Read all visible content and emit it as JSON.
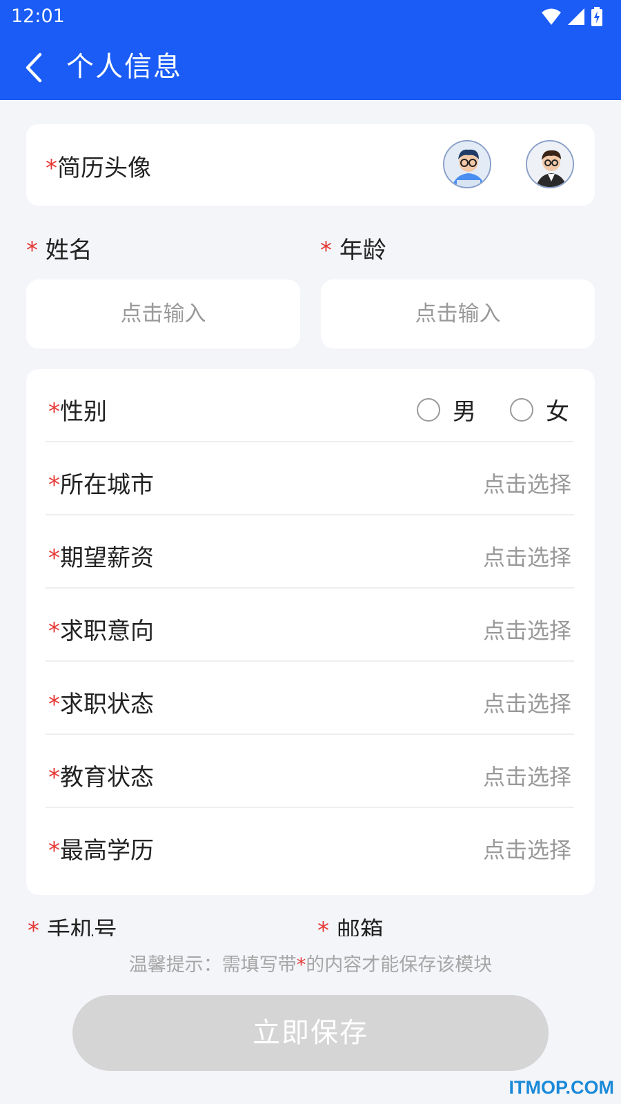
{
  "status_bar": {
    "time": "12:01",
    "icons": [
      "wifi-icon",
      "signal-icon",
      "battery-charging-icon"
    ]
  },
  "app_bar": {
    "title": "个人信息",
    "back_icon": "chevron-left-icon"
  },
  "avatar_section": {
    "required_mark": "*",
    "label": "简历头像",
    "avatars": [
      "male-avatar-blue-shirt",
      "male-avatar-black-suit"
    ]
  },
  "name_field": {
    "required_mark": "*",
    "label": "姓名",
    "placeholder": "点击输入"
  },
  "age_field": {
    "required_mark": "*",
    "label": "年龄",
    "placeholder": "点击输入"
  },
  "form_rows": {
    "gender": {
      "required_mark": "*",
      "label": "性别",
      "options": [
        "男",
        "女"
      ]
    },
    "city": {
      "required_mark": "*",
      "label": "所在城市",
      "value": "点击选择"
    },
    "salary": {
      "required_mark": "*",
      "label": "期望薪资",
      "value": "点击选择"
    },
    "intention": {
      "required_mark": "*",
      "label": "求职意向",
      "value": "点击选择"
    },
    "job_status": {
      "required_mark": "*",
      "label": "求职状态",
      "value": "点击选择"
    },
    "edu_status": {
      "required_mark": "*",
      "label": "教育状态",
      "value": "点击选择"
    },
    "degree": {
      "required_mark": "*",
      "label": "最高学历",
      "value": "点击选择"
    }
  },
  "phone_field": {
    "required_mark": "*",
    "label": "手机号"
  },
  "email_field": {
    "required_mark": "*",
    "label": "邮箱"
  },
  "hint": {
    "prefix": "温馨提示：需填写带",
    "mark": "*",
    "suffix": "的内容才能保存该模块"
  },
  "save_button": {
    "label": "立即保存"
  },
  "watermark": "ITMOP.COM",
  "colors": {
    "primary": "#1a5cf5",
    "required": "#e53935",
    "button_disabled": "#d5d5d5",
    "watermark": "#1a8ad8"
  }
}
